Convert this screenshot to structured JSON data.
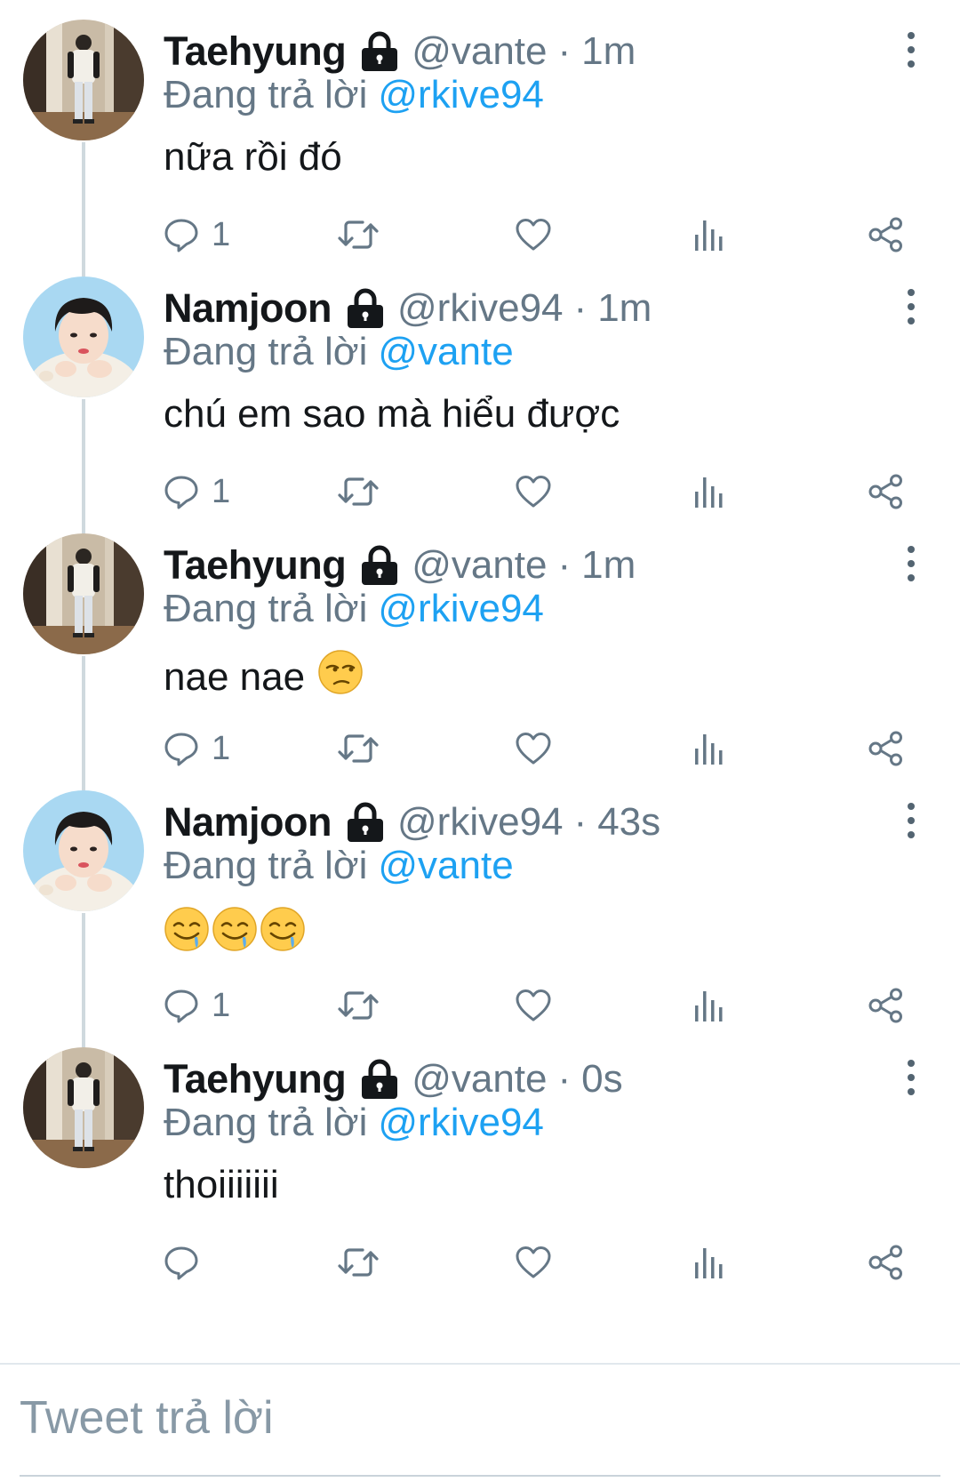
{
  "tweets": [
    {
      "author": "Taehyung",
      "avatar": "taehyung",
      "handle": "@vante",
      "time": "1m",
      "reply_prefix": "Đang trả lời",
      "reply_to": "@rkive94",
      "text": "nữa rồi đó",
      "emojis": [],
      "reply_count": "1"
    },
    {
      "author": "Namjoon",
      "avatar": "namjoon",
      "handle": "@rkive94",
      "time": "1m",
      "reply_prefix": "Đang trả lời",
      "reply_to": "@vante",
      "text": "chú em sao mà hiểu được",
      "emojis": [],
      "reply_count": "1"
    },
    {
      "author": "Taehyung",
      "avatar": "taehyung",
      "handle": "@vante",
      "time": "1m",
      "reply_prefix": "Đang trả lời",
      "reply_to": "@rkive94",
      "text": "nae nae",
      "emojis": [
        "unamused-face"
      ],
      "reply_count": "1"
    },
    {
      "author": "Namjoon",
      "avatar": "namjoon",
      "handle": "@rkive94",
      "time": "43s",
      "reply_prefix": "Đang trả lời",
      "reply_to": "@vante",
      "text": "",
      "emojis": [
        "drooling-face",
        "drooling-face",
        "drooling-face"
      ],
      "reply_count": "1"
    },
    {
      "author": "Taehyung",
      "avatar": "taehyung",
      "handle": "@vante",
      "time": "0s",
      "reply_prefix": "Đang trả lời",
      "reply_to": "@rkive94",
      "text": "thoiiiiiii",
      "emojis": [],
      "reply_count": ""
    }
  ],
  "separator": "·",
  "icons": {
    "lock": "lock-icon",
    "more": "more-vertical-icon",
    "reply": "reply-icon",
    "retweet": "retweet-icon",
    "like": "heart-icon",
    "analytics": "analytics-icon",
    "share": "share-icon"
  },
  "colors": {
    "accent": "#1da1f2",
    "secondary_text": "#657786",
    "primary_text": "#14171a",
    "thread_line": "#cfd9de"
  },
  "compose": {
    "placeholder": "Tweet trả lời"
  }
}
